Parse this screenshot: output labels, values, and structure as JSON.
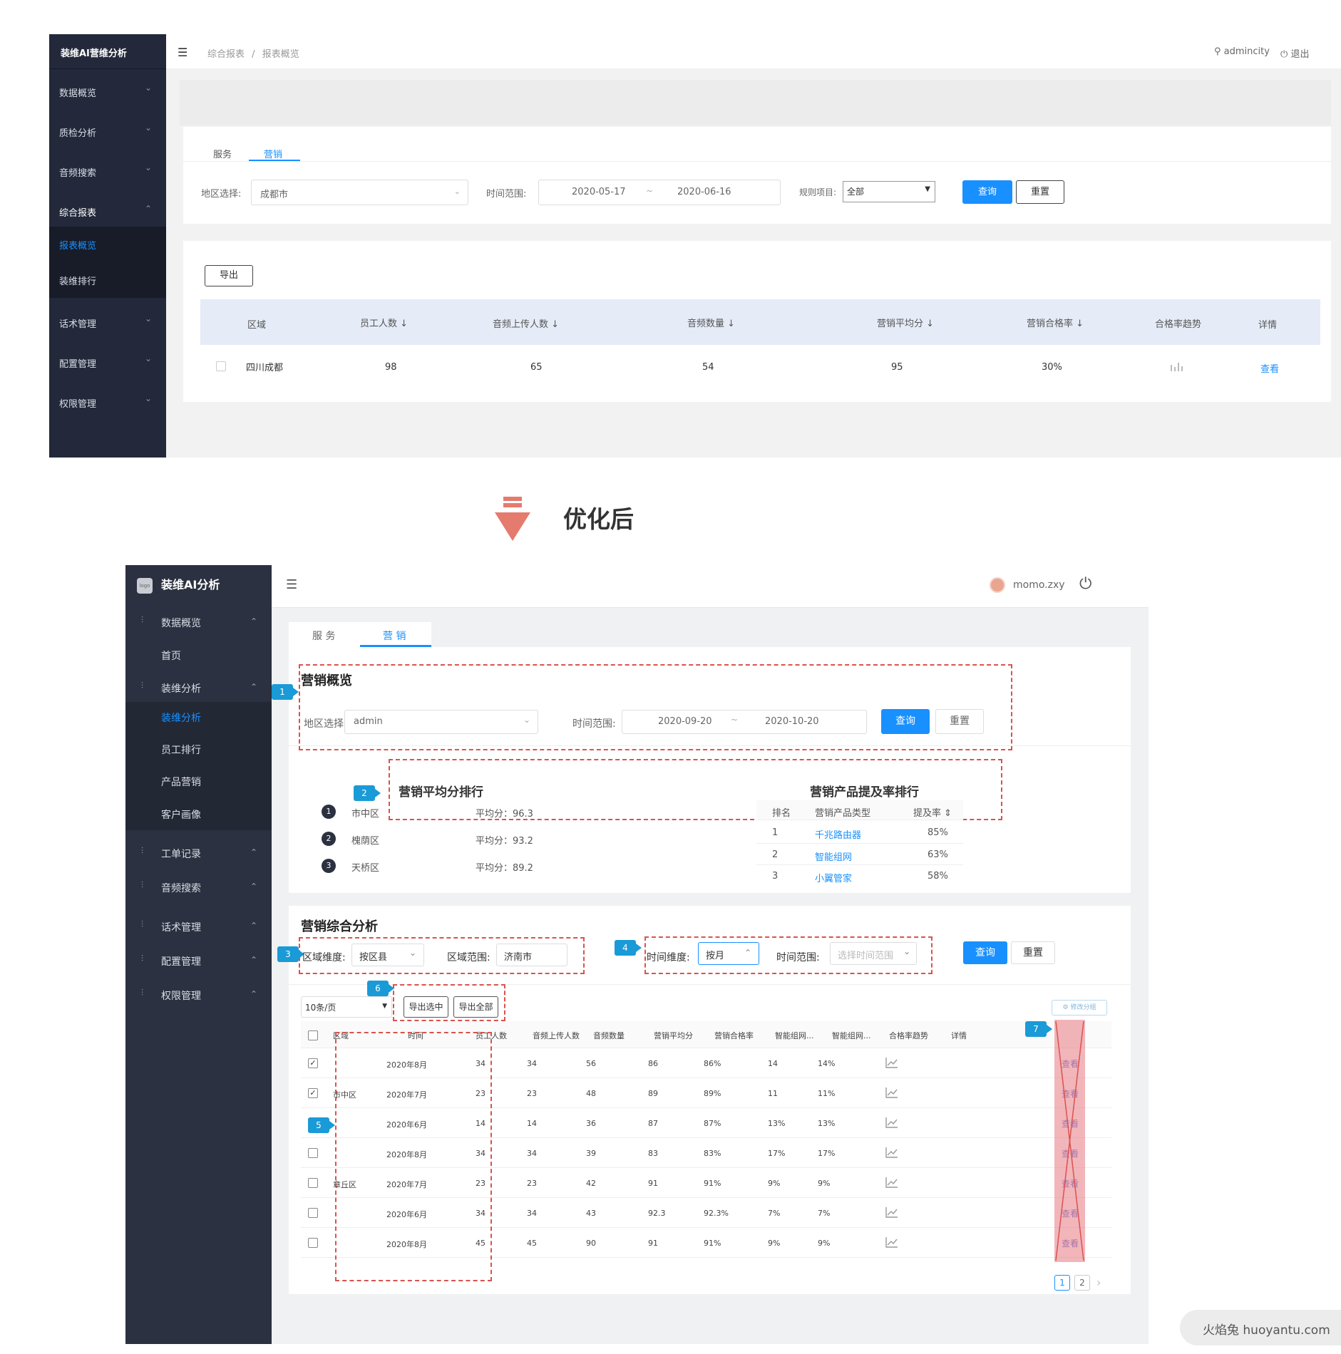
{
  "before": {
    "sidebar": {
      "title": "装维AI营维分析",
      "items": [
        {
          "label": "数据概览"
        },
        {
          "label": "质检分析"
        },
        {
          "label": "音频搜索"
        },
        {
          "label": "综合报表"
        },
        {
          "label": "报表概览"
        },
        {
          "label": "装维排行"
        },
        {
          "label": "话术管理"
        },
        {
          "label": "配置管理"
        },
        {
          "label": "权限管理"
        }
      ]
    },
    "header": {
      "breadcrumb_root": "综合报表",
      "breadcrumb_sep": "/",
      "breadcrumb_current": "报表概览",
      "user": "admincity",
      "logout": "退出"
    },
    "tabs": [
      "服务",
      "营销"
    ],
    "filters": {
      "region_label": "地区选择:",
      "region_value": "成都市",
      "time_label": "时间范围:",
      "start_date": "2020-05-17",
      "range_sep": "~",
      "end_date": "2020-06-16",
      "rule_label": "规则项目:",
      "rule_value": "全部",
      "query": "查询",
      "reset": "重置"
    },
    "export": "导出",
    "table": {
      "headers": [
        "区域",
        "员工人数 ↓",
        "音频上传人数 ↓",
        "音频数量 ↓",
        "营销平均分 ↓",
        "营销合格率 ↓",
        "合格率趋势",
        "详情"
      ],
      "row": {
        "region": "四川成都",
        "employees": "98",
        "uploaders": "65",
        "audios": "54",
        "avg": "95",
        "rate": "30%",
        "detail": "查看"
      }
    }
  },
  "divider": {
    "title": "优化后"
  },
  "after": {
    "sidebar": {
      "logo": "logo",
      "title": "装维AI分析",
      "items": [
        {
          "label": "数据概览"
        },
        {
          "label": "首页"
        },
        {
          "label": "装维分析"
        },
        {
          "label": "装维分析"
        },
        {
          "label": "员工排行"
        },
        {
          "label": "产品营销"
        },
        {
          "label": "客户画像"
        },
        {
          "label": "工单记录"
        },
        {
          "label": "音频搜索"
        },
        {
          "label": "话术管理"
        },
        {
          "label": "配置管理"
        },
        {
          "label": "权限管理"
        }
      ]
    },
    "header": {
      "user": "momo.zxy"
    },
    "tabs": [
      "服 务",
      "营 销"
    ],
    "overview": {
      "title": "营销概览",
      "region_label": "地区选择:",
      "region_value": "admin",
      "time_label": "时间范围:",
      "start_date": "2020-09-20",
      "range_sep": "~",
      "end_date": "2020-10-20",
      "query": "查询",
      "reset": "重置"
    },
    "ranking": {
      "title": "营销平均分排行",
      "items": [
        {
          "rank": "1",
          "name": "市中区",
          "score": "平均分：96.3"
        },
        {
          "rank": "2",
          "name": "槐荫区",
          "score": "平均分：93.2"
        },
        {
          "rank": "3",
          "name": "天桥区",
          "score": "平均分：89.2"
        }
      ]
    },
    "product": {
      "title": "营销产品提及率排行",
      "headers": [
        "排名",
        "营销产品类型",
        "提及率 ⇕"
      ],
      "rows": [
        {
          "rank": "1",
          "name": "千兆路由器",
          "rate": "85%"
        },
        {
          "rank": "2",
          "name": "智能组网",
          "rate": "63%"
        },
        {
          "rank": "3",
          "name": "小翼管家",
          "rate": "58%"
        }
      ]
    },
    "analysis": {
      "title": "营销综合分析",
      "dim_label": "区域维度:",
      "dim_value": "按区县",
      "scope_label": "区域范围:",
      "scope_value": "济南市",
      "time_dim_label": "时间维度:",
      "time_dim_value": "按月",
      "time_range_label": "时间范围:",
      "time_range_placeholder": "选择时间范围",
      "query": "查询",
      "reset": "重置",
      "page_size": "10条/页",
      "export_selected": "导出选中",
      "export_all": "导出全部",
      "modify": "⚙ 修改分组",
      "headers": [
        "区域",
        "时间",
        "员工人数",
        "音频上传人数",
        "音频数量",
        "营销平均分",
        "营销合格率",
        "智能组网...",
        "智能组网...",
        "合格率趋势",
        "详情"
      ],
      "rows": [
        {
          "region": "",
          "time": "2020年8月",
          "emp": "34",
          "up": "34",
          "aud": "56",
          "avg": "86",
          "rate": "86%",
          "n1": "14",
          "n2": "14%",
          "detail": "查看",
          "checked": true
        },
        {
          "region": "市中区",
          "time": "2020年7月",
          "emp": "23",
          "up": "23",
          "aud": "48",
          "avg": "89",
          "rate": "89%",
          "n1": "11",
          "n2": "11%",
          "detail": "查看",
          "checked": true
        },
        {
          "region": "",
          "time": "2020年6月",
          "emp": "14",
          "up": "14",
          "aud": "36",
          "avg": "87",
          "rate": "87%",
          "n1": "13%",
          "n2": "13%",
          "detail": "查看",
          "checked": false
        },
        {
          "region": "",
          "time": "2020年8月",
          "emp": "34",
          "up": "34",
          "aud": "39",
          "avg": "83",
          "rate": "83%",
          "n1": "17%",
          "n2": "17%",
          "detail": "查看",
          "checked": false
        },
        {
          "region": "章丘区",
          "time": "2020年7月",
          "emp": "23",
          "up": "23",
          "aud": "42",
          "avg": "91",
          "rate": "91%",
          "n1": "9%",
          "n2": "9%",
          "detail": "查看",
          "checked": false
        },
        {
          "region": "",
          "time": "2020年6月",
          "emp": "34",
          "up": "34",
          "aud": "43",
          "avg": "92.3",
          "rate": "92.3%",
          "n1": "7%",
          "n2": "7%",
          "detail": "查看",
          "checked": false
        },
        {
          "region": "",
          "time": "2020年8月",
          "emp": "45",
          "up": "45",
          "aud": "90",
          "avg": "91",
          "rate": "91%",
          "n1": "9%",
          "n2": "9%",
          "detail": "查看",
          "checked": false
        }
      ],
      "pages": [
        "1",
        "2"
      ],
      "next": "›"
    },
    "markers": [
      "1",
      "2",
      "3",
      "4",
      "5",
      "6",
      "7"
    ]
  },
  "watermark": "火焰兔 huoyantu.com",
  "colors": {
    "sidebar_bg": "#23293a",
    "accent": "#1890ff",
    "annotation": "#d9534f",
    "marker": "#1a9ad6"
  }
}
